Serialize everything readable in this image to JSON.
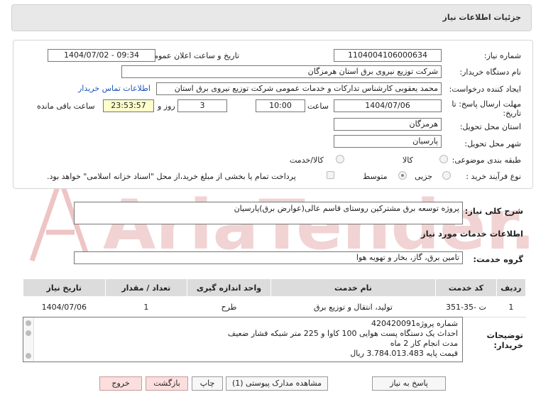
{
  "page_title": "جزئیات اطلاعات نیاز",
  "fields": {
    "need_number_label": "شماره نیاز:",
    "need_number": "1104004106000634",
    "announce_label": "تاریخ و ساعت اعلان عمومی:",
    "announce_value": "1404/07/02 - 09:34",
    "buyer_label": "نام دستگاه خریدار:",
    "buyer_value": "شرکت توزیع نیروی برق استان هرمزگان",
    "creator_label": "ایجاد کننده درخواست:",
    "creator_value": "محمد یعقوبی کارشناس تدارکات و خدمات عمومی شرکت توزیع نیروی برق استان",
    "contact_link": "اطلاعات تماس خریدار",
    "deadline_label_1": "مهلت ارسال پاسخ: تا",
    "deadline_label_2": "تاریخ:",
    "deadline_date": "1404/07/06",
    "time_label": "ساعت",
    "deadline_time": "10:00",
    "days_value": "3",
    "days_label": "روز و",
    "remaining_time": "23:53:57",
    "remaining_label": "ساعت باقی مانده",
    "province_label": "استان محل تحویل:",
    "province_value": "هرمزگان",
    "city_label": "شهر محل تحویل:",
    "city_value": "پارسیان",
    "category_label": "طبقه بندی موضوعی:",
    "category_options": [
      "کالا",
      "کالا/خدمت"
    ],
    "process_label": "نوع فرآیند خرید :",
    "process_options": [
      "جزیی",
      "متوسط"
    ],
    "payment_note": "پرداخت تمام یا بخشی از مبلغ خرید،از محل \"اسناد خزانه اسلامی\" خواهد بود."
  },
  "summary": {
    "label": "شرح کلی نیاز:",
    "value": "پروژه توسعه برق مشترکین روستای قاسم عالی(عوارض برق)پارسیان"
  },
  "services": {
    "section_title": "اطلاعات خدمات مورد نیاز",
    "group_label": "گروه خدمت:",
    "group_value": "تامین برق، گاز، بخار و تهویه هوا",
    "headers": [
      "ردیف",
      "کد خدمت",
      "نام خدمت",
      "واحد اندازه گیری",
      "تعداد / مقدار",
      "تاریخ نیاز"
    ],
    "rows": [
      [
        "1",
        "ت -35-351",
        "تولید، انتقال و توزیع برق",
        "طرح",
        "1",
        "1404/07/06"
      ]
    ]
  },
  "buyer_notes": {
    "label_1": "توضیحات",
    "label_2": "خریدار:",
    "lines": [
      "شماره پروژه420420091",
      "احداث یک دستگاه پست هوایی 100 کاوا و 225 متر شبکه فشار ضعیف",
      "مدت انجام کار 2 ماه",
      "قیمت پایه 3.784.013.483 ریال"
    ]
  },
  "buttons": {
    "reply": "پاسخ به نیاز",
    "docs": "مشاهده مدارک پیوستی (1)",
    "print": "چاپ",
    "back": "بازگشت",
    "exit": "خروج"
  },
  "watermark": "AriaTender.net",
  "colors": {
    "link": "#1a55c0",
    "highlight": "#ffffcc",
    "watermark": "#e6b3b3"
  }
}
